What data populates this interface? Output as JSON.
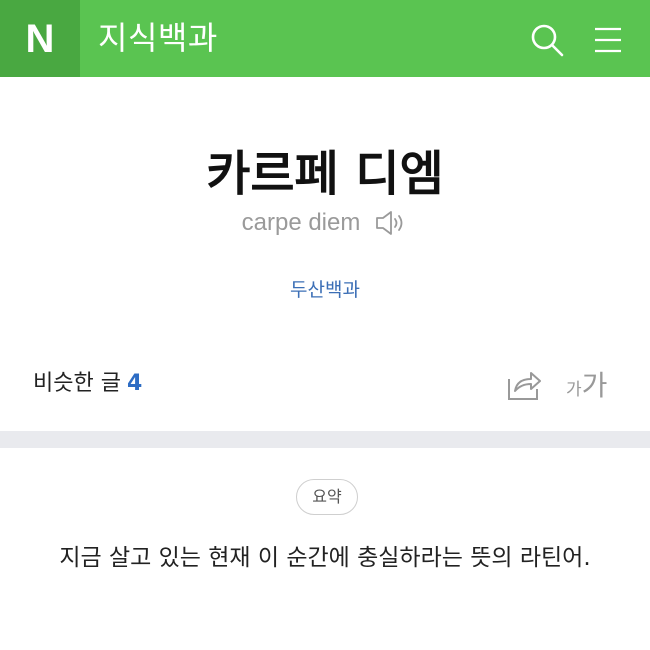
{
  "header": {
    "logo_text": "N",
    "service_title": "지식백과",
    "icons": {
      "search": "search-icon",
      "menu": "hamburger-menu-icon"
    },
    "colors": {
      "bar": "#5ac451",
      "logo_bg": "#49a841"
    }
  },
  "entry": {
    "title": "카르페 디엠",
    "pronunciation": "carpe diem",
    "speaker_icon": "speaker-icon",
    "source": "두산백과"
  },
  "tools": {
    "similar_label": "비슷한 글",
    "similar_count": "4",
    "share_icon": "share-icon",
    "font_small": "가",
    "font_large": "가"
  },
  "summary": {
    "badge": "요약",
    "text": "지금 살고 있는 현재 이 순간에 충실하라는 뜻의 라틴어."
  }
}
